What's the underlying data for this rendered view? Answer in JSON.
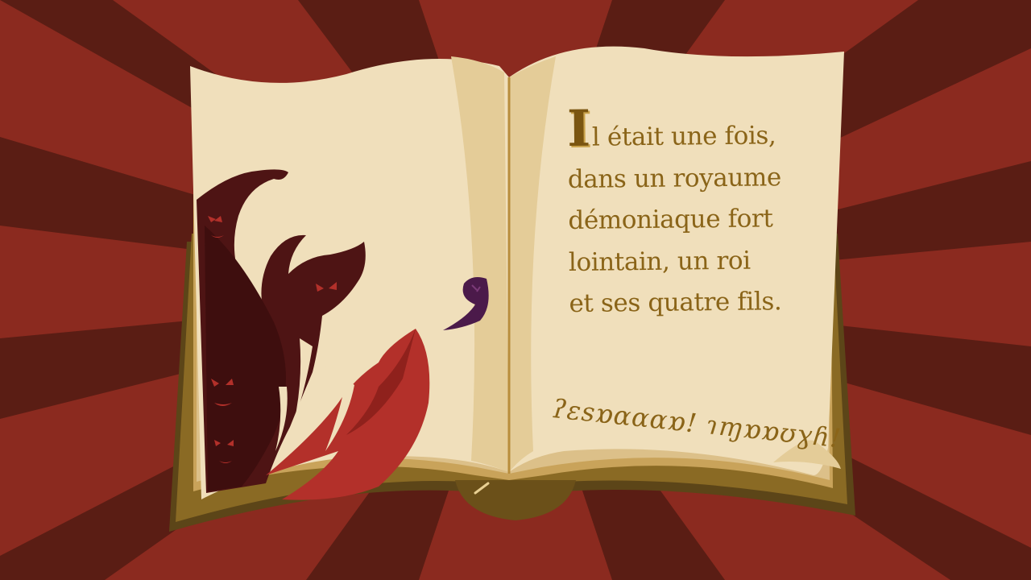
{
  "story": {
    "drop_cap": "I",
    "lines": [
      "l était une fois,",
      "dans un royaume",
      "démoniaque fort",
      "lointain, un roi",
      "et ses quatre fils."
    ]
  },
  "signature": "ʔɛsɒɑɑɑɒ! ɿɱɒɒʊɣɦ!",
  "colors": {
    "ray_light": "#8b2a1f",
    "ray_dark": "#5a1d14",
    "page": "#f0dfbb",
    "book_cover": "#8a6a24",
    "ink": "#8a6418",
    "demon": "#4e1414",
    "demon_accent": "#b3302a",
    "wisp": "#4b1a4a"
  }
}
